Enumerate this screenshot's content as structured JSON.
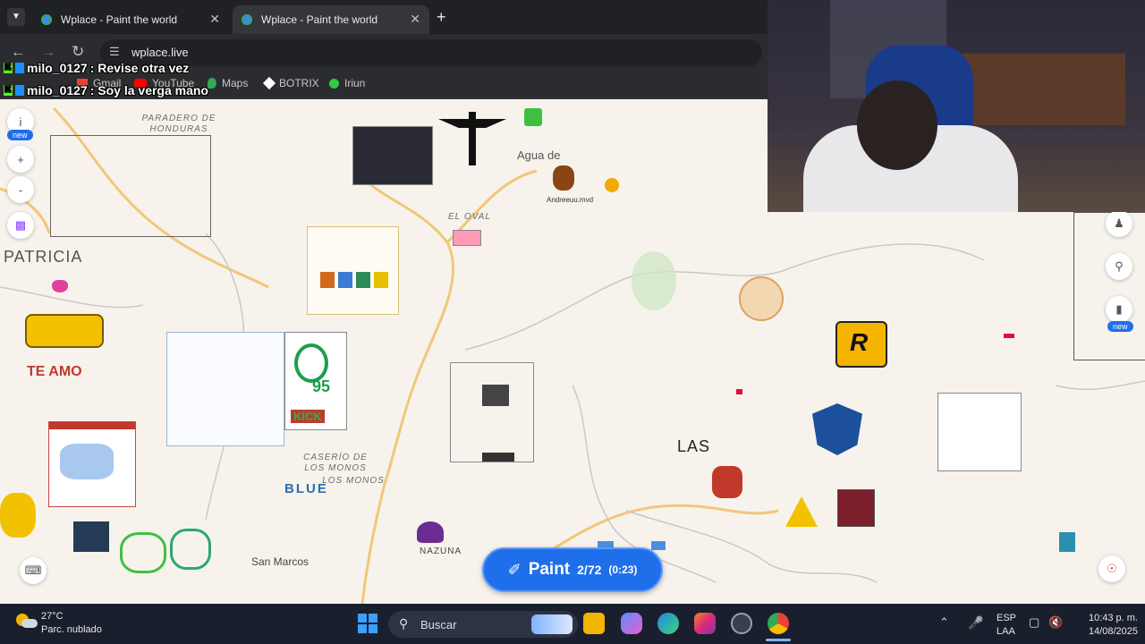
{
  "browser": {
    "tabs": [
      {
        "title": "Wplace - Paint the world"
      },
      {
        "title": "Wplace - Paint the world"
      }
    ],
    "new_tab_icon": "plus-icon",
    "address": "wplace.live",
    "bookmarks": [
      {
        "label": "Gmail"
      },
      {
        "label": "YouTube"
      },
      {
        "label": "Maps"
      },
      {
        "label": "BOTRIX"
      },
      {
        "label": "Iriun"
      }
    ]
  },
  "chat": [
    {
      "user": "milo_0127",
      "message": " : Revise otra vez"
    },
    {
      "user": "milo_0127",
      "message": " : Soy la verga mano"
    }
  ],
  "map_labels": {
    "paradero_1": "PARADERO DE",
    "paradero_2": "HONDURAS",
    "agua": "Agua de",
    "el_oval": "EL OVAL",
    "caserio_1": "CASERÍO DE",
    "caserio_2": "LOS MONOS",
    "los_monos": "LOS MONOS",
    "san_marcos": "San Marcos",
    "patricia": "PATRICIA",
    "te_amo": "TE AMO",
    "blue": "BLUE",
    "nazuna": "NAZUNA",
    "las": "LAS",
    "kick": "KICK",
    "k95": "95",
    "andrew": "Andreeuu.mvd"
  },
  "left_controls": {
    "info_icon": "info-icon",
    "new_badge": "new",
    "zoom_in": "+",
    "zoom_out": "-"
  },
  "right_controls": {
    "new_badge": "new"
  },
  "paint_button": {
    "label": "Paint",
    "count": "2/72",
    "timer": "(0:23)"
  },
  "taskbar": {
    "weather_temp": "27°C",
    "weather_desc": "Parc. nublado",
    "search_placeholder": "Buscar",
    "lang_1": "ESP",
    "lang_2": "LAA",
    "time": "10:43 p. m.",
    "date": "14/08/2025"
  },
  "colors": {
    "accent": "#1f6feb",
    "road": "#f2c67a",
    "map_bg": "#f7f3ec",
    "kick_green": "#53fc18"
  }
}
